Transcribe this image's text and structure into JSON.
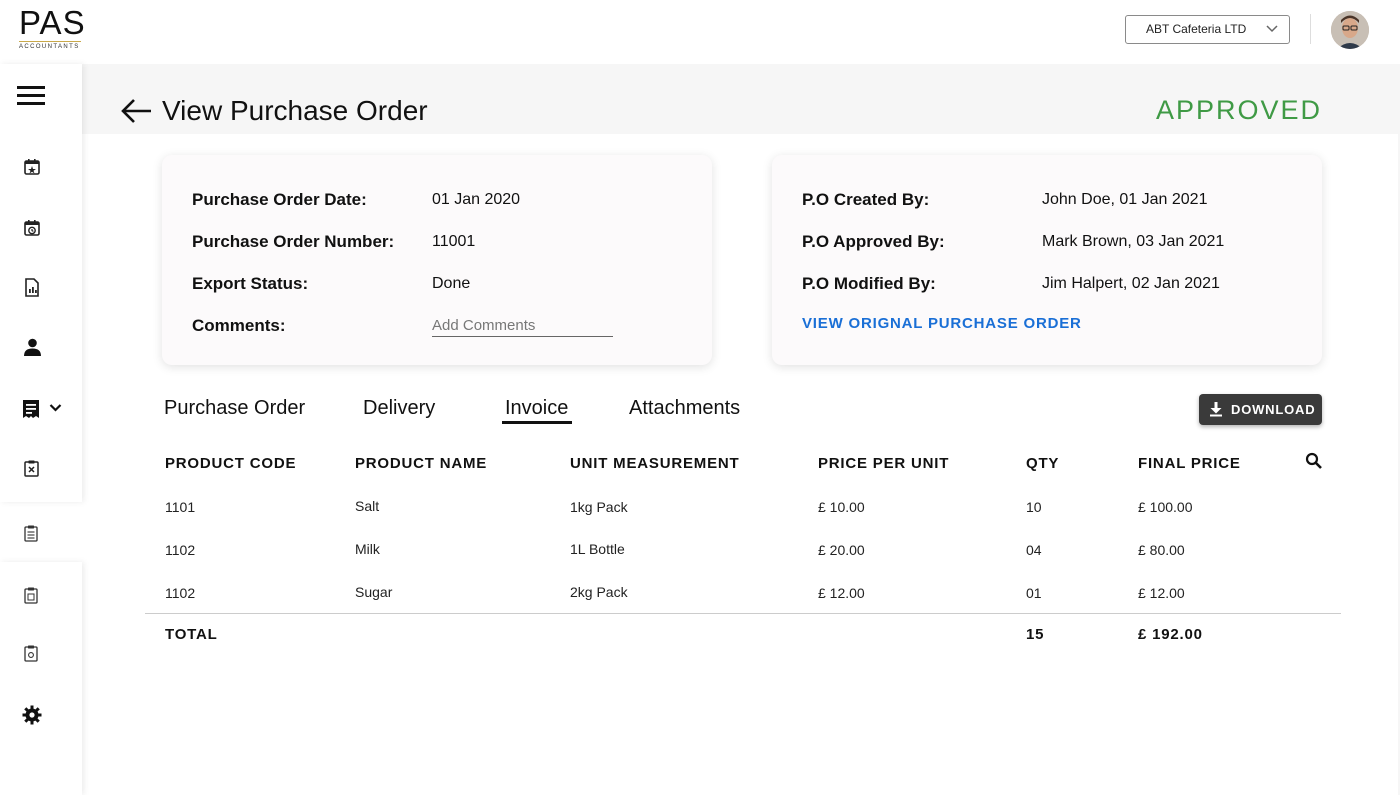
{
  "logo": {
    "main": "PAS",
    "sub": "ACCOUNTANTS"
  },
  "header": {
    "company": "ABT Cafeteria LTD"
  },
  "page": {
    "title": "View Purchase Order",
    "status": "APPROVED",
    "status_color": "#3f9a45"
  },
  "order_info": {
    "date_label": "Purchase Order Date:",
    "date_value": "01 Jan 2020",
    "number_label": "Purchase Order Number:",
    "number_value": "11001",
    "export_label": "Export Status:",
    "export_value": "Done",
    "comments_label": "Comments:",
    "comments_placeholder": "Add Comments"
  },
  "audit_info": {
    "created_label": "P.O Created By:",
    "created_value": "John Doe, 01 Jan 2021",
    "approved_label": "P.O Approved By:",
    "approved_value": "Mark Brown, 03 Jan 2021",
    "modified_label": "P.O Modified By:",
    "modified_value": "Jim Halpert, 02 Jan 2021",
    "link": "VIEW ORIGNAL PURCHASE ORDER",
    "link_color": "#1a6fd6"
  },
  "tabs": [
    "Purchase Order",
    "Delivery",
    "Invoice",
    "Attachments"
  ],
  "active_tab": "Invoice",
  "download_label": "DOWNLOAD",
  "table": {
    "columns": [
      "PRODUCT CODE",
      "PRODUCT NAME",
      "UNIT MEASUREMENT",
      "PRICE PER UNIT",
      "QTY",
      "FINAL PRICE"
    ],
    "rows": [
      [
        "1101",
        "Salt",
        "1kg Pack",
        "£ 10.00",
        "10",
        "£ 100.00"
      ],
      [
        "1102",
        "Milk",
        "1L Bottle",
        "£ 20.00",
        "04",
        "£ 80.00"
      ],
      [
        "1102",
        "Sugar",
        "2kg Pack",
        "£ 12.00",
        "01",
        "£ 12.00"
      ]
    ],
    "total_label": "TOTAL",
    "total_qty": "15",
    "total_price": "£ 192.00"
  },
  "sidebar_icons": [
    "menu-icon",
    "calendar-star-icon",
    "calendar-clock-icon",
    "document-chart-icon",
    "person-icon",
    "receipt-icon",
    "chevron-down-icon",
    "clipboard-x-icon",
    "clipboard-list-icon",
    "clipboard-doc-icon",
    "clipboard-gear-icon",
    "settings-gear-icon"
  ]
}
